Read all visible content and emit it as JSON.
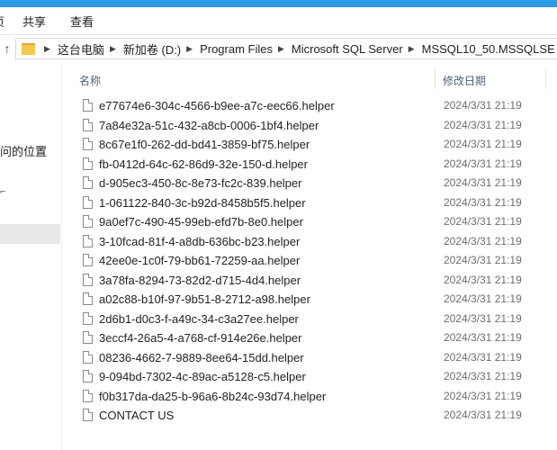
{
  "ribbon": {
    "tabs": [
      "页",
      "共享",
      "查看"
    ]
  },
  "address": {
    "crumbs": [
      "这台电脑",
      "新加卷 (D:)",
      "Program Files",
      "Microsoft SQL Server",
      "MSSQL10_50.MSSQLSE"
    ]
  },
  "nav": {
    "location_text": "问的位置"
  },
  "header": {
    "name": "名称",
    "date": "修改日期"
  },
  "files": [
    {
      "name": "e77674e6-304c-4566-b9ee-a7c-eec66.helper",
      "date": "2024/3/31 21:19"
    },
    {
      "name": "7a84e32a-51c-432-a8cb-0006-1bf4.helper",
      "date": "2024/3/31 21:19"
    },
    {
      "name": "8c67e1f0-262-dd-bd41-3859-bf75.helper",
      "date": "2024/3/31 21:19"
    },
    {
      "name": "fb-0412d-64c-62-86d9-32e-150-d.helper",
      "date": "2024/3/31 21:19"
    },
    {
      "name": "d-905ec3-450-8c-8e73-fc2c-839.helper",
      "date": "2024/3/31 21:19"
    },
    {
      "name": "1-061122-840-3c-b92d-8458b5f5.helper",
      "date": "2024/3/31 21:19"
    },
    {
      "name": "9a0ef7c-490-45-99eb-efd7b-8e0.helper",
      "date": "2024/3/31 21:19"
    },
    {
      "name": "3-10fcad-81f-4-a8db-636bc-b23.helper",
      "date": "2024/3/31 21:19"
    },
    {
      "name": "42ee0e-1c0f-79-bb61-72259-aa.helper",
      "date": "2024/3/31 21:19"
    },
    {
      "name": "3a78fa-8294-73-82d2-d715-4d4.helper",
      "date": "2024/3/31 21:19"
    },
    {
      "name": "a02c88-b10f-97-9b51-8-2712-a98.helper",
      "date": "2024/3/31 21:19"
    },
    {
      "name": "2d6b1-d0c3-f-a49c-34-c3a27ee.helper",
      "date": "2024/3/31 21:19"
    },
    {
      "name": "3eccf4-26a5-4-a768-cf-914e26e.helper",
      "date": "2024/3/31 21:19"
    },
    {
      "name": "08236-4662-7-9889-8ee64-15dd.helper",
      "date": "2024/3/31 21:19"
    },
    {
      "name": "9-094bd-7302-4c-89ac-a5128-c5.helper",
      "date": "2024/3/31 21:19"
    },
    {
      "name": "f0b317da-da25-b-96a6-8b24c-93d74.helper",
      "date": "2024/3/31 21:19"
    },
    {
      "name": "CONTACT US",
      "date": "2024/3/31 21:19"
    }
  ]
}
